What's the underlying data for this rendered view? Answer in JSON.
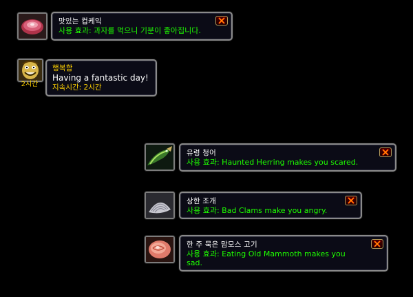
{
  "colors": {
    "use_text": "#1eff00",
    "title_gold": "#ffd100",
    "white": "#ffffff",
    "border": "#8a8a8a"
  },
  "items": [
    {
      "id": "cupcake",
      "icon": "cupcake-icon",
      "name": "맛있는 컵케익",
      "use": "사용 효과: 과자를 먹으니 기분이 좋아집니다."
    },
    {
      "id": "herring",
      "icon": "herring-icon",
      "name": "유령 청어",
      "use": "사용 효과: Haunted Herring makes you scared."
    },
    {
      "id": "clams",
      "icon": "clam-icon",
      "name": "상한 조개",
      "use": "사용 효과: Bad Clams make you angry."
    },
    {
      "id": "mammoth",
      "icon": "mammoth-meat-icon",
      "name": "한 주 묵은 맘모스 고기",
      "use_line1": "사용 효과: Eating Old Mammoth makes you",
      "use_line2": "sad."
    }
  ],
  "buff": {
    "icon": "happy-face-icon",
    "name": "행복함",
    "description": "Having a fantastic day!",
    "remaining": "지속시간: 2시간",
    "duration_label": "2시간"
  }
}
